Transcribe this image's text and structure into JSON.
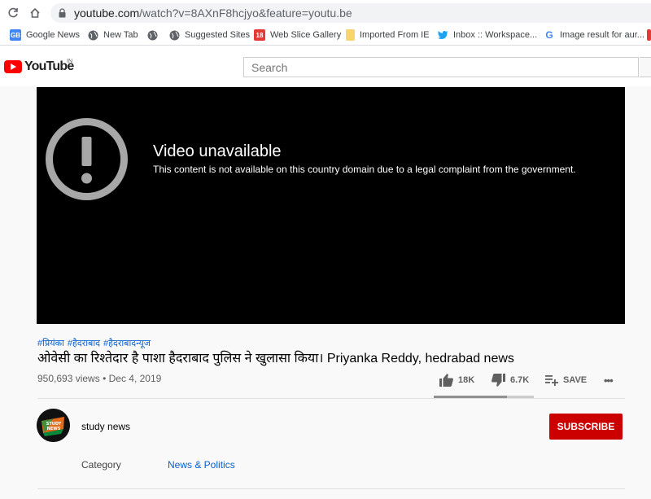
{
  "browser": {
    "url_host": "youtube.com",
    "url_path": "/watch?v=8AXnF8hcjyo&feature=youtu.be"
  },
  "bookmarks": [
    {
      "label": "Google News",
      "icon": "google-news-icon",
      "color": "#4285f4"
    },
    {
      "label": "New Tab",
      "icon": "globe-icon",
      "color": "#5f6368"
    },
    {
      "label": "Suggested Sites",
      "icon": "globe-icon",
      "color": "#5f6368"
    },
    {
      "label": "Web Slice Gallery",
      "icon": "slice-icon",
      "color": "#e53935"
    },
    {
      "label": "Imported From IE",
      "icon": "folder-icon",
      "color": "#f9d56e"
    },
    {
      "label": "Inbox :: Workspace...",
      "icon": "twitter-bird-icon",
      "color": "#1da1f2"
    },
    {
      "label": "Image result for aur...",
      "icon": "google-g-icon",
      "color": "#4285f4"
    }
  ],
  "youtube": {
    "logo_text": "YouTube",
    "country": "IN",
    "search_placeholder": "Search"
  },
  "player": {
    "error_title": "Video unavailable",
    "error_message": "This content is not available on this country domain due to a legal complaint from the government."
  },
  "video": {
    "hashtags": [
      "#प्रियंका",
      "#हैदराबाद",
      "#हैदराबादन्यूज"
    ],
    "title": "ओवेसी का रिश्तेदार है पाशा हैदराबाद पुलिस ने खुलासा किया। Priyanka Reddy, hedrabad news",
    "views": "950,693 views",
    "separator": "•",
    "date": "Dec 4, 2019",
    "likes": "18K",
    "dislikes": "6.7K",
    "save_label": "SAVE",
    "more_label": "•••",
    "like_ratio": 0.73
  },
  "channel": {
    "name": "study news",
    "avatar_text": "STUDY NEWS",
    "subscribe_label": "SUBSCRIBE"
  },
  "category": {
    "label": "Category",
    "value": "News & Politics"
  },
  "colors": {
    "brand_red": "#ff0000",
    "subscribe_red": "#cc0000",
    "link_blue": "#065fd4"
  }
}
